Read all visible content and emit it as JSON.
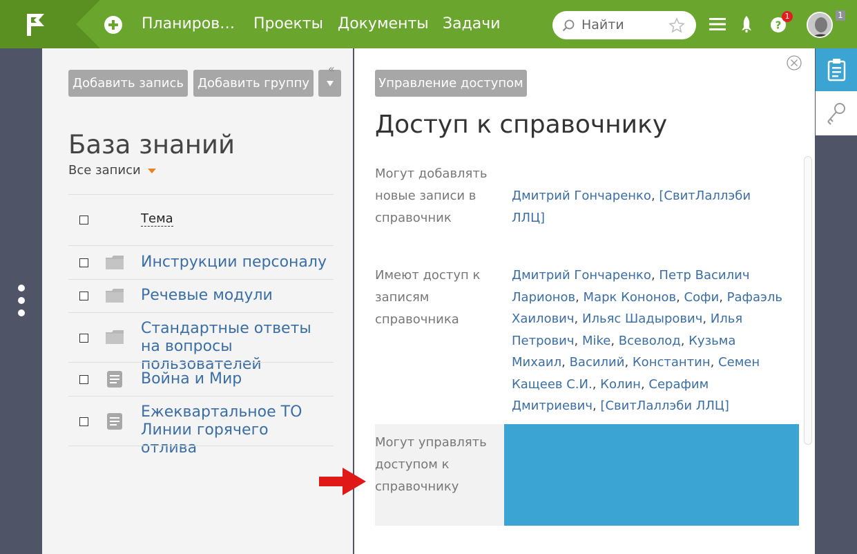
{
  "topbar": {
    "nav": [
      "Планиров…",
      "Проекты",
      "Документы",
      "Задачи"
    ],
    "search_placeholder": "Найти",
    "help_badge": "1",
    "avatar_count": "1"
  },
  "left": {
    "add_record": "Добавить запись",
    "add_group": "Добавить группу",
    "collapse": "«",
    "title": "База знаний",
    "filter": "Все записи",
    "column_theme": "Тема",
    "rows": [
      {
        "label": "Инструкции персоналу",
        "icon": "folder-icon"
      },
      {
        "label": "Речевые модули",
        "icon": "folder-icon"
      },
      {
        "label": "Стандартные ответы на вопросы пользователей",
        "icon": "folder-icon"
      },
      {
        "label": "Война и Мир",
        "icon": "document-icon"
      },
      {
        "label": "Ежеквартальное ТО Линии горячего отлива",
        "icon": "document-icon"
      }
    ]
  },
  "right": {
    "manage_access": "Управление доступом",
    "title": "Доступ к справочнику",
    "sections": [
      {
        "label": "Могут добавлять новые записи в справочник",
        "people": [
          "Дмитрий Гончаренко",
          "[СвитЛаллэби ЛЛЦ]"
        ]
      },
      {
        "label": "Имеют доступ к записям справочника",
        "people": [
          "Дмитрий Гончаренко",
          "Петр Василич Ларионов",
          "Марк Кононов",
          "Софи",
          "Рафаэль Хаилович",
          "Ильяс Шадырович",
          "Илья Петрович",
          "Mike",
          "Всеволод",
          "Кузьма Михаил",
          "Василий",
          "Константин",
          "Семен Кащеев С.И.",
          "Колин",
          "Серафим Дмитриевич",
          "[СвитЛаллэби ЛЛЦ]"
        ]
      },
      {
        "label": "Могут управлять доступом к справочнику",
        "people": []
      }
    ]
  },
  "colors": {
    "topbar": "#6aa52d",
    "link": "#3a6ea5",
    "highlight": "#3ba4d3",
    "arrow": "#e01818"
  }
}
